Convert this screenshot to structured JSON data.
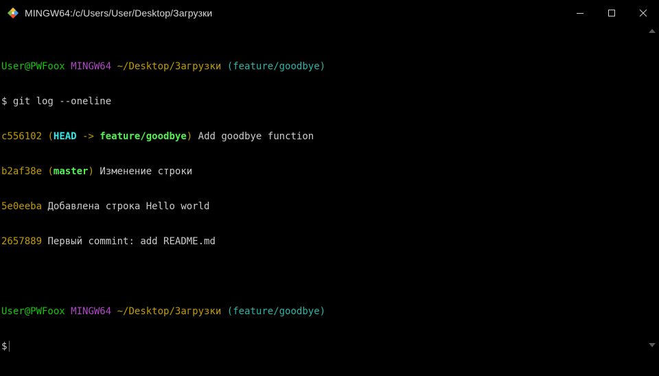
{
  "window": {
    "title": "MINGW64:/c/Users/User/Desktop/Загрузки",
    "icons": {
      "app": "git-bash-icon",
      "minimize": "minimize-icon",
      "maximize": "maximize-icon",
      "close": "close-icon"
    }
  },
  "terminal": {
    "prompt1": {
      "user_host": "User@PWFoox",
      "system": "MINGW64",
      "path": "~/Desktop/Загрузки",
      "branch": "(feature/goodbye)"
    },
    "command": "$ git log --oneline",
    "commits": [
      {
        "hash": "c556102",
        "refs_open": "(",
        "head": "HEAD",
        "arrow": " -> ",
        "branch": "feature/goodbye",
        "refs_close": ")",
        "message": "Add goodbye function"
      },
      {
        "hash": "b2af38e",
        "refs_open": "(",
        "branch": "master",
        "refs_close": ")",
        "message": "Изменение строки"
      },
      {
        "hash": "5e0eeba",
        "message": "Добавлена строка Hello world"
      },
      {
        "hash": "2657889",
        "message": "Первый commint: add README.md"
      }
    ],
    "prompt2": {
      "user_host": "User@PWFoox",
      "system": "MINGW64",
      "path": "~/Desktop/Загрузки",
      "branch": "(feature/goodbye)"
    },
    "input_prompt": "$"
  },
  "colors": {
    "user_host": "#16c60c",
    "system": "#b148c6",
    "path": "#c19c00",
    "branch": "#2cb5a8",
    "hash": "#c19c00",
    "head": "#31e7e7",
    "local_branch": "#54ef54",
    "text": "#cccccc"
  }
}
